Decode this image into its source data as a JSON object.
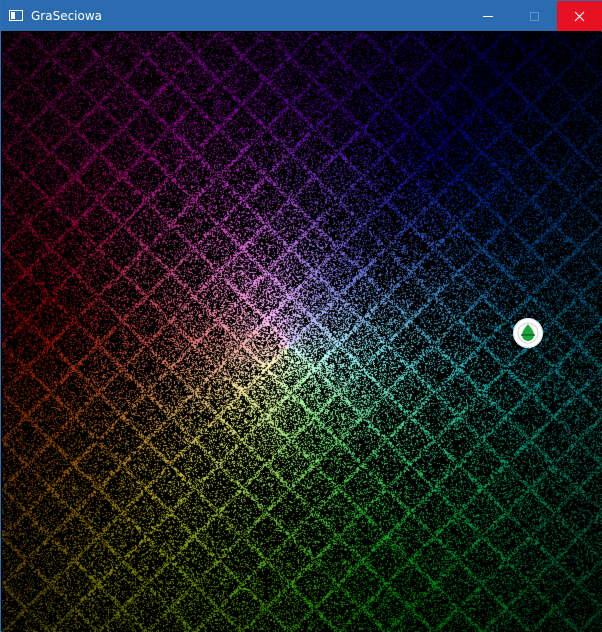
{
  "window": {
    "title": "GraSeciowa",
    "icon": "app-window-icon",
    "controls": {
      "minimize": "minimize-icon",
      "maximize": "maximize-icon",
      "close": "close-icon"
    }
  },
  "colors": {
    "titlebar": "#2b6cb0",
    "close_button": "#e81123",
    "background": "#000000",
    "player_ring": "#ffffff",
    "player_fill": "#1aa53a"
  },
  "game": {
    "player_icon": "green-drop-marker-icon"
  }
}
